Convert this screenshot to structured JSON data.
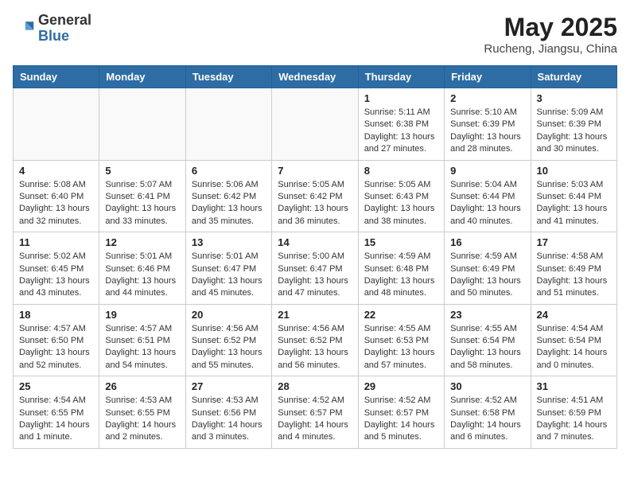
{
  "header": {
    "logo_general": "General",
    "logo_blue": "Blue",
    "month_title": "May 2025",
    "location": "Rucheng, Jiangsu, China"
  },
  "weekdays": [
    "Sunday",
    "Monday",
    "Tuesday",
    "Wednesday",
    "Thursday",
    "Friday",
    "Saturday"
  ],
  "weeks": [
    [
      {
        "day": "",
        "info": ""
      },
      {
        "day": "",
        "info": ""
      },
      {
        "day": "",
        "info": ""
      },
      {
        "day": "",
        "info": ""
      },
      {
        "day": "1",
        "info": "Sunrise: 5:11 AM\nSunset: 6:38 PM\nDaylight: 13 hours\nand 27 minutes."
      },
      {
        "day": "2",
        "info": "Sunrise: 5:10 AM\nSunset: 6:39 PM\nDaylight: 13 hours\nand 28 minutes."
      },
      {
        "day": "3",
        "info": "Sunrise: 5:09 AM\nSunset: 6:39 PM\nDaylight: 13 hours\nand 30 minutes."
      }
    ],
    [
      {
        "day": "4",
        "info": "Sunrise: 5:08 AM\nSunset: 6:40 PM\nDaylight: 13 hours\nand 32 minutes."
      },
      {
        "day": "5",
        "info": "Sunrise: 5:07 AM\nSunset: 6:41 PM\nDaylight: 13 hours\nand 33 minutes."
      },
      {
        "day": "6",
        "info": "Sunrise: 5:06 AM\nSunset: 6:42 PM\nDaylight: 13 hours\nand 35 minutes."
      },
      {
        "day": "7",
        "info": "Sunrise: 5:05 AM\nSunset: 6:42 PM\nDaylight: 13 hours\nand 36 minutes."
      },
      {
        "day": "8",
        "info": "Sunrise: 5:05 AM\nSunset: 6:43 PM\nDaylight: 13 hours\nand 38 minutes."
      },
      {
        "day": "9",
        "info": "Sunrise: 5:04 AM\nSunset: 6:44 PM\nDaylight: 13 hours\nand 40 minutes."
      },
      {
        "day": "10",
        "info": "Sunrise: 5:03 AM\nSunset: 6:44 PM\nDaylight: 13 hours\nand 41 minutes."
      }
    ],
    [
      {
        "day": "11",
        "info": "Sunrise: 5:02 AM\nSunset: 6:45 PM\nDaylight: 13 hours\nand 43 minutes."
      },
      {
        "day": "12",
        "info": "Sunrise: 5:01 AM\nSunset: 6:46 PM\nDaylight: 13 hours\nand 44 minutes."
      },
      {
        "day": "13",
        "info": "Sunrise: 5:01 AM\nSunset: 6:47 PM\nDaylight: 13 hours\nand 45 minutes."
      },
      {
        "day": "14",
        "info": "Sunrise: 5:00 AM\nSunset: 6:47 PM\nDaylight: 13 hours\nand 47 minutes."
      },
      {
        "day": "15",
        "info": "Sunrise: 4:59 AM\nSunset: 6:48 PM\nDaylight: 13 hours\nand 48 minutes."
      },
      {
        "day": "16",
        "info": "Sunrise: 4:59 AM\nSunset: 6:49 PM\nDaylight: 13 hours\nand 50 minutes."
      },
      {
        "day": "17",
        "info": "Sunrise: 4:58 AM\nSunset: 6:49 PM\nDaylight: 13 hours\nand 51 minutes."
      }
    ],
    [
      {
        "day": "18",
        "info": "Sunrise: 4:57 AM\nSunset: 6:50 PM\nDaylight: 13 hours\nand 52 minutes."
      },
      {
        "day": "19",
        "info": "Sunrise: 4:57 AM\nSunset: 6:51 PM\nDaylight: 13 hours\nand 54 minutes."
      },
      {
        "day": "20",
        "info": "Sunrise: 4:56 AM\nSunset: 6:52 PM\nDaylight: 13 hours\nand 55 minutes."
      },
      {
        "day": "21",
        "info": "Sunrise: 4:56 AM\nSunset: 6:52 PM\nDaylight: 13 hours\nand 56 minutes."
      },
      {
        "day": "22",
        "info": "Sunrise: 4:55 AM\nSunset: 6:53 PM\nDaylight: 13 hours\nand 57 minutes."
      },
      {
        "day": "23",
        "info": "Sunrise: 4:55 AM\nSunset: 6:54 PM\nDaylight: 13 hours\nand 58 minutes."
      },
      {
        "day": "24",
        "info": "Sunrise: 4:54 AM\nSunset: 6:54 PM\nDaylight: 14 hours\nand 0 minutes."
      }
    ],
    [
      {
        "day": "25",
        "info": "Sunrise: 4:54 AM\nSunset: 6:55 PM\nDaylight: 14 hours\nand 1 minute."
      },
      {
        "day": "26",
        "info": "Sunrise: 4:53 AM\nSunset: 6:55 PM\nDaylight: 14 hours\nand 2 minutes."
      },
      {
        "day": "27",
        "info": "Sunrise: 4:53 AM\nSunset: 6:56 PM\nDaylight: 14 hours\nand 3 minutes."
      },
      {
        "day": "28",
        "info": "Sunrise: 4:52 AM\nSunset: 6:57 PM\nDaylight: 14 hours\nand 4 minutes."
      },
      {
        "day": "29",
        "info": "Sunrise: 4:52 AM\nSunset: 6:57 PM\nDaylight: 14 hours\nand 5 minutes."
      },
      {
        "day": "30",
        "info": "Sunrise: 4:52 AM\nSunset: 6:58 PM\nDaylight: 14 hours\nand 6 minutes."
      },
      {
        "day": "31",
        "info": "Sunrise: 4:51 AM\nSunset: 6:59 PM\nDaylight: 14 hours\nand 7 minutes."
      }
    ]
  ]
}
